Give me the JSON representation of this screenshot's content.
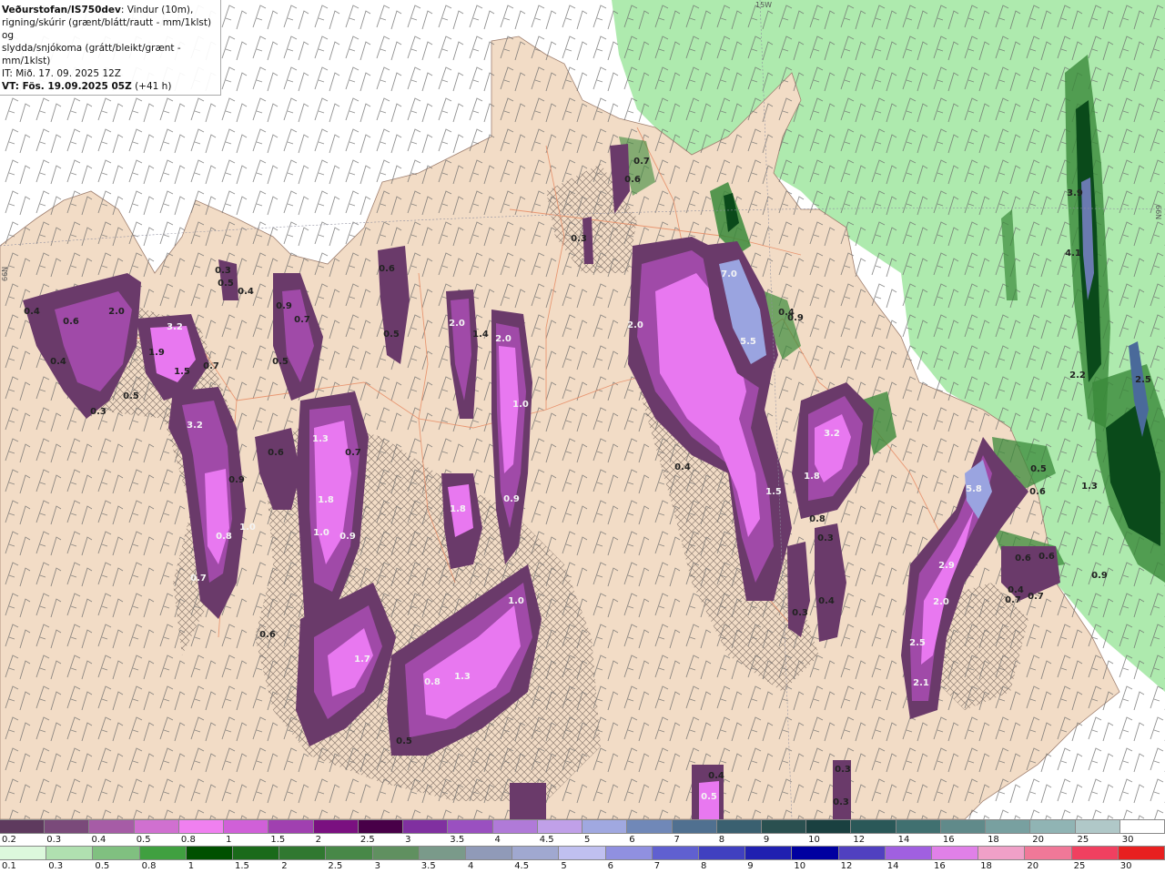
{
  "header": {
    "model_title": "Veðurstofan/IS750dev",
    "description_1": ": Vindur (10m),",
    "description_2": "rigning/skúrir (grænt/blátt/rautt - mm/1klst) og",
    "description_3": "slydda/snjókoma (grátt/bleikt/grænt - mm/1klst)",
    "initial_time": "IT: Mið. 17. 09. 2025 12Z",
    "valid_time": "VT: Fös. 19.09.2025 05Z",
    "lead_time": "(+41 h)"
  },
  "map": {
    "grid_labels": [
      {
        "text": "15W"
      },
      {
        "text": "66N"
      },
      {
        "text": "66N"
      }
    ],
    "value_labels": [
      {
        "text": "0.4"
      },
      {
        "text": "0.6"
      },
      {
        "text": "2.0"
      },
      {
        "text": "3.2"
      },
      {
        "text": "1.9"
      },
      {
        "text": "1.5"
      },
      {
        "text": "0.4"
      },
      {
        "text": "0.5"
      },
      {
        "text": "0.3"
      },
      {
        "text": "3.2"
      },
      {
        "text": "0.9"
      },
      {
        "text": "0.7"
      },
      {
        "text": "1.0"
      },
      {
        "text": "0.8"
      },
      {
        "text": "0.7"
      },
      {
        "text": "0.5"
      },
      {
        "text": "0.4"
      },
      {
        "text": "0.9"
      },
      {
        "text": "0.7"
      },
      {
        "text": "0.5"
      },
      {
        "text": "0.6"
      },
      {
        "text": "1.3"
      },
      {
        "text": "1.8"
      },
      {
        "text": "1.0"
      },
      {
        "text": "0.9"
      },
      {
        "text": "0.7"
      },
      {
        "text": "0.6"
      },
      {
        "text": "0.3"
      },
      {
        "text": "0.5"
      },
      {
        "text": "2.0"
      },
      {
        "text": "1.4"
      },
      {
        "text": "2.0"
      },
      {
        "text": "1.0"
      },
      {
        "text": "1.8"
      },
      {
        "text": "0.9"
      },
      {
        "text": "1.0"
      },
      {
        "text": "1.7"
      },
      {
        "text": "0.8"
      },
      {
        "text": "1.3"
      },
      {
        "text": "0.5"
      },
      {
        "text": "0.3"
      },
      {
        "text": "0.7"
      },
      {
        "text": "0.6"
      },
      {
        "text": "0.6"
      },
      {
        "text": "2.0"
      },
      {
        "text": "7.0"
      },
      {
        "text": "5.5"
      },
      {
        "text": "0.4"
      },
      {
        "text": "0.9"
      },
      {
        "text": "0.4"
      },
      {
        "text": "1.5"
      },
      {
        "text": "3.2"
      },
      {
        "text": "1.8"
      },
      {
        "text": "0.8"
      },
      {
        "text": "0.3"
      },
      {
        "text": "0.4"
      },
      {
        "text": "0.3"
      },
      {
        "text": "3.9"
      },
      {
        "text": "4.1"
      },
      {
        "text": "2.2"
      },
      {
        "text": "2.5"
      },
      {
        "text": "1.3"
      },
      {
        "text": "5.8"
      },
      {
        "text": "0.5"
      },
      {
        "text": "0.6"
      },
      {
        "text": "0.6"
      },
      {
        "text": "0.6"
      },
      {
        "text": "2.9"
      },
      {
        "text": "0.4"
      },
      {
        "text": "0.7"
      },
      {
        "text": "0.7"
      },
      {
        "text": "2.0"
      },
      {
        "text": "0.9"
      },
      {
        "text": "2.5"
      },
      {
        "text": "2.1"
      },
      {
        "text": "0.4"
      },
      {
        "text": "0.5"
      },
      {
        "text": "0.3"
      },
      {
        "text": "0.3"
      }
    ]
  },
  "legend_top": {
    "labels": [
      "0.2",
      "0.3",
      "0.4",
      "0.5",
      "0.8",
      "1",
      "1.5",
      "2",
      "2.5",
      "3",
      "3.5",
      "4",
      "4.5",
      "5",
      "6",
      "7",
      "8",
      "9",
      "10",
      "12",
      "14",
      "16",
      "18",
      "20",
      "25",
      "30"
    ],
    "colors": [
      "#5e3a5e",
      "#7a4a7a",
      "#a65ca6",
      "#d070d0",
      "#f080f0",
      "#d060d8",
      "#a040b0",
      "#7a1080",
      "#480048",
      "#8030a0",
      "#9a50c0",
      "#b07ad8",
      "#c0a0e8",
      "#a0a8e0",
      "#7088b8",
      "#507090",
      "#3a6070",
      "#2a5050",
      "#1a4040",
      "#2a5858",
      "#407070",
      "#608a8a",
      "#78a0a0",
      "#90b4b4",
      "#b0c8c8",
      "#ffffff"
    ]
  },
  "legend_bottom": {
    "labels": [
      "0.1",
      "0.3",
      "0.5",
      "0.8",
      "1",
      "1.5",
      "2",
      "2.5",
      "3",
      "3.5",
      "4",
      "4.5",
      "5",
      "6",
      "7",
      "8",
      "9",
      "10",
      "12",
      "14",
      "16",
      "18",
      "20",
      "25",
      "30"
    ],
    "colors": [
      "#dcf8dc",
      "#b0e0b0",
      "#80c080",
      "#40a040",
      "#005000",
      "#1a6a1a",
      "#307830",
      "#488848",
      "#609060",
      "#7a9a8a",
      "#909ab8",
      "#a0a8d0",
      "#c0c0f0",
      "#9090e0",
      "#6060d0",
      "#4040c0",
      "#2020b0",
      "#0000a0",
      "#5040c0",
      "#a060e0",
      "#e080e8",
      "#f0a0c8",
      "#f07898",
      "#f04060",
      "#e82020"
    ]
  },
  "colors": {
    "land": "#f2dcc6",
    "sea": "#ffffff",
    "rain_light": "#aeeaae",
    "rain_mid": "#3a8a3a",
    "rain_dark": "#0a4a1a",
    "snow_dark": "#6a3a6a",
    "snow_mid": "#a04aa8",
    "snow_bright": "#e878f0",
    "snow_blue": "#9aa4e0",
    "roads": "#e8906a"
  }
}
